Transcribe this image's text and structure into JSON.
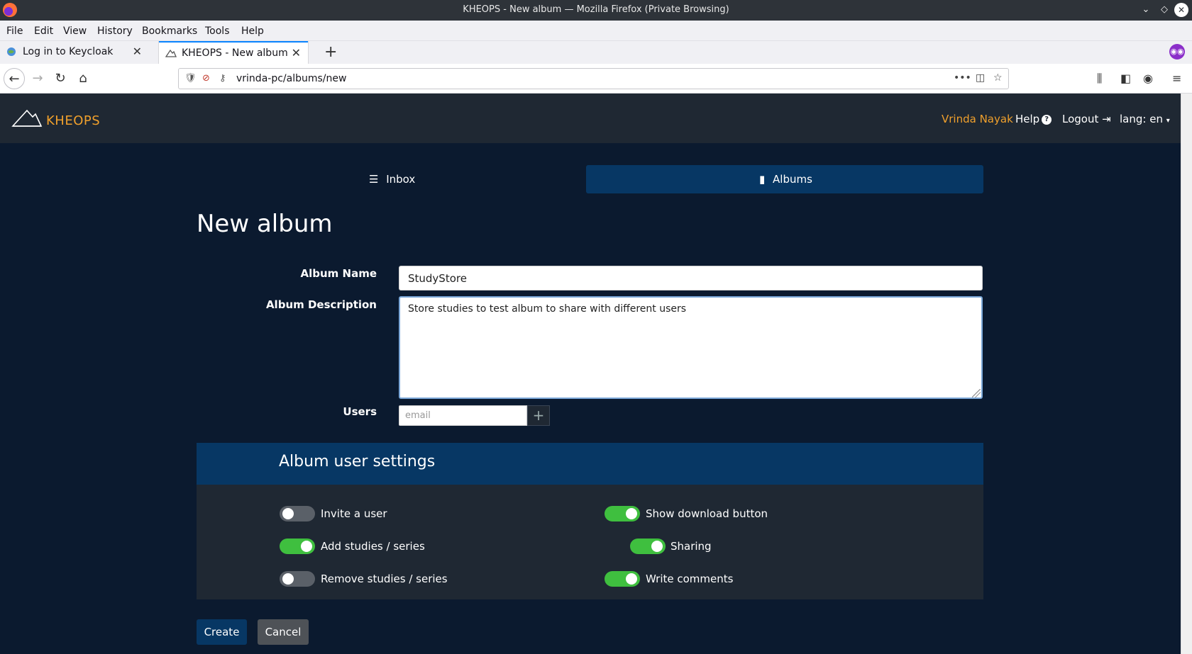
{
  "window": {
    "title": "KHEOPS - New album — Mozilla Firefox (Private Browsing)"
  },
  "menubar": {
    "items": [
      "File",
      "Edit",
      "View",
      "History",
      "Bookmarks",
      "Tools",
      "Help"
    ]
  },
  "tabs": [
    {
      "label": "Log in to Keycloak",
      "active": false
    },
    {
      "label": "KHEOPS - New album",
      "active": true
    }
  ],
  "urlbar": {
    "url": "vrinda-pc/albums/new"
  },
  "site": {
    "brand": "KHEOPS",
    "user_name": "Vrinda Nayak",
    "help_label": "Help",
    "logout_label": "Logout",
    "lang_label": "lang: en",
    "brand_color": "#f0a02c"
  },
  "nav": {
    "inbox_label": "Inbox",
    "albums_label": "Albums",
    "active": "Albums"
  },
  "form": {
    "page_title": "New album",
    "album_name_label": "Album Name",
    "album_name_value": "StudyStore",
    "album_description_label": "Album Description",
    "album_description_value": "Store studies to test album to share with different users",
    "users_label": "Users",
    "users_placeholder": "email"
  },
  "settings": {
    "title": "Album user settings",
    "toggles": [
      {
        "label": "Invite a user",
        "on": false
      },
      {
        "label": "Add studies / series",
        "on": true
      },
      {
        "label": "Remove studies / series",
        "on": false
      },
      {
        "label": "Show download button",
        "on": true
      },
      {
        "label": "Sharing",
        "on": true
      },
      {
        "label": "Write comments",
        "on": true
      }
    ],
    "on_color": "#3fbf3f",
    "off_color": "#5a6068"
  },
  "actions": {
    "create_label": "Create",
    "cancel_label": "Cancel"
  }
}
